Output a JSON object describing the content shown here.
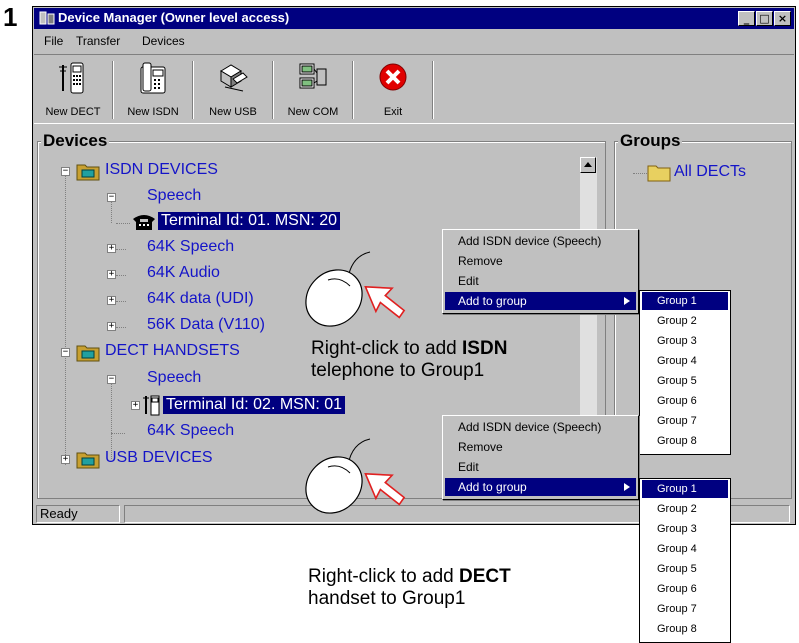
{
  "step_number": "1",
  "window": {
    "title": "Device Manager (Owner level access)",
    "controls": [
      "_",
      "□",
      "×"
    ]
  },
  "menu": [
    "File",
    "Transfer",
    "Devices"
  ],
  "toolbar": [
    {
      "label": "New DECT",
      "icon": "dect-handset-icon"
    },
    {
      "label": "New ISDN",
      "icon": "isdn-phone-icon"
    },
    {
      "label": "New USB",
      "icon": "usb-devices-icon"
    },
    {
      "label": "New COM",
      "icon": "com-port-icon"
    },
    {
      "label": "Exit",
      "icon": "exit-icon"
    }
  ],
  "devices_panel": {
    "title": "Devices",
    "tree": [
      {
        "label": "ISDN DEVICES",
        "expander": "−"
      },
      {
        "label": "Speech",
        "expander": "−"
      },
      {
        "label": "Terminal Id: 01.  MSN: 20"
      },
      {
        "label": "64K Speech",
        "expander": "+"
      },
      {
        "label": "64K Audio",
        "expander": "+"
      },
      {
        "label": "64K data (UDI)",
        "expander": "+"
      },
      {
        "label": "56K Data (V110)",
        "expander": "+"
      },
      {
        "label": "DECT HANDSETS",
        "expander": "−"
      },
      {
        "label": "Speech",
        "expander": "−"
      },
      {
        "label": "Terminal Id: 02. MSN: 01",
        "expander": "+"
      },
      {
        "label": "64K Speech"
      },
      {
        "label": "USB DEVICES",
        "expander": "+"
      }
    ]
  },
  "groups_panel": {
    "title": "Groups",
    "items": [
      "All DECTs"
    ]
  },
  "context_menu": [
    "Add ISDN device (Speech)",
    "Remove",
    "Edit",
    "Add to group"
  ],
  "group_submenu": [
    "Group 1",
    "Group 2",
    "Group 3",
    "Group 4",
    "Group 5",
    "Group 6",
    "Group 7",
    "Group 8"
  ],
  "status_bar": {
    "text": "Ready"
  },
  "annotations": {
    "isdn": {
      "prefix": "Right-click to add ",
      "bold": "ISDN",
      "suffix": "telephone to Group1"
    },
    "dect": {
      "prefix": "Right-click to add ",
      "bold": "DECT",
      "suffix": "handset to Group1"
    }
  },
  "colors": {
    "titlebar": "#000080",
    "tree_text": "#1414c8",
    "selection": "#000080",
    "arrow": "#e02020",
    "window_face": "#c0c0c0"
  }
}
